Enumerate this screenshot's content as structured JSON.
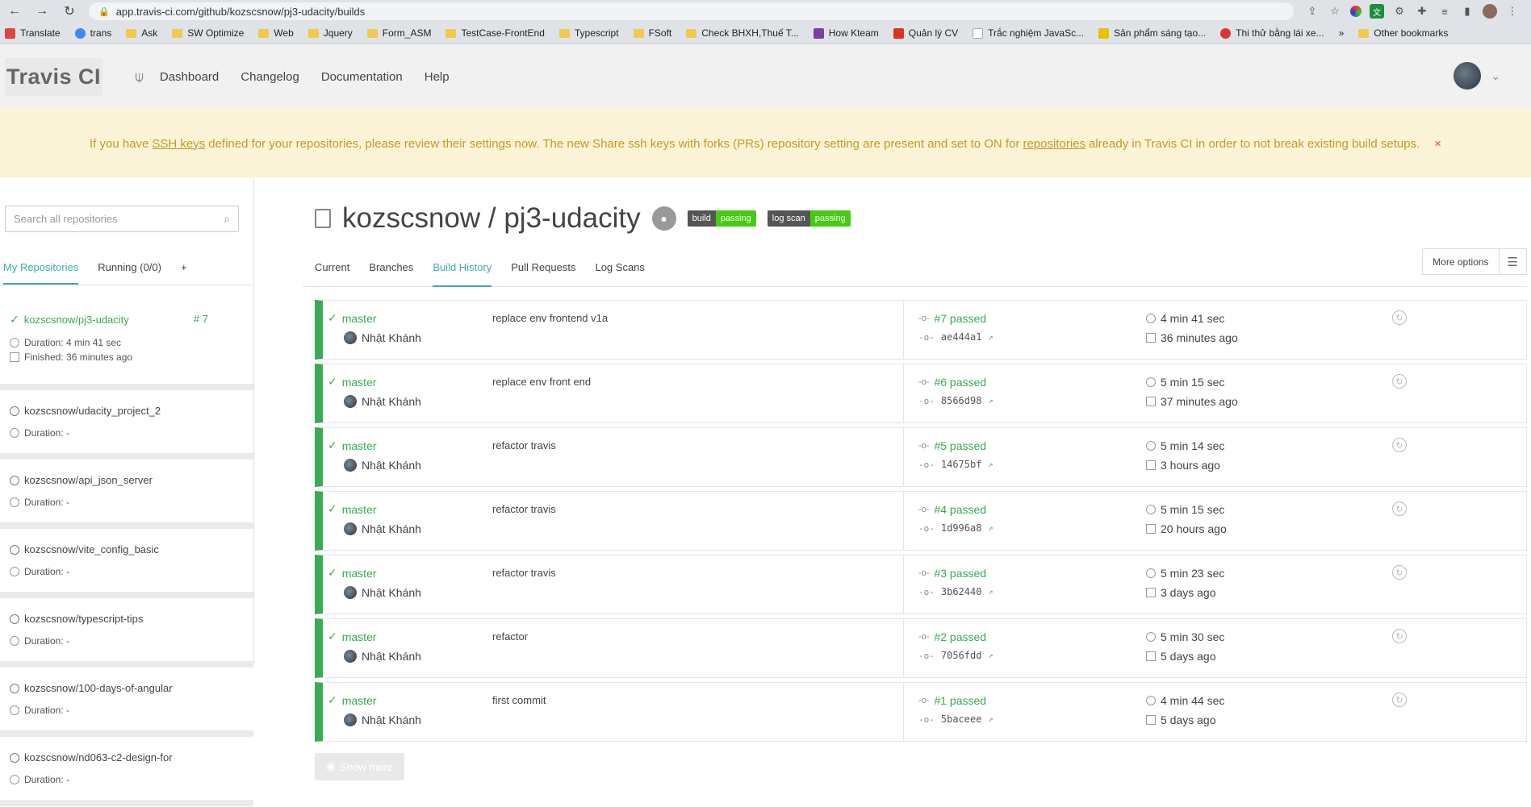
{
  "browser": {
    "url": "app.travis-ci.com/github/kozscsnow/pj3-udacity/builds",
    "bookmarks": [
      "Translate",
      "trans",
      "Ask",
      "SW Optimize",
      "Web",
      "Jquery",
      "Form_ASM",
      "TestCase-FrontEnd",
      "Typescript",
      "FSoft",
      "Check BHXH,Thuế T...",
      "How Kteam",
      "Quản lý CV",
      "Trắc nghiệm JavaSc...",
      "Sản phẩm sáng tạo...",
      "Thi thử bằng lái xe...",
      "»",
      "Other bookmarks"
    ]
  },
  "nav": {
    "logo": "Travis CI",
    "links": [
      "Dashboard",
      "Changelog",
      "Documentation",
      "Help"
    ]
  },
  "banner": {
    "prefix": "If you have",
    "link1": "SSH keys",
    "middle": "defined for your repositories, please review their settings now. The new Share ssh keys with forks (PRs) repository setting are present and set to ON for",
    "link2": "repositories",
    "suffix": "already in Travis CI in order to not break existing build setups.",
    "close": "×"
  },
  "sidebar": {
    "search_placeholder": "Search all repositories",
    "tabs": [
      "My Repositories",
      "Running (0/0)",
      "+"
    ],
    "repos": [
      {
        "name": "kozscsnow/pj3-udacity",
        "number": "7",
        "duration": "Duration: 4 min 41 sec",
        "finished": "Finished: 36 minutes ago"
      },
      {
        "name": "kozscsnow/udacity_project_2",
        "duration": "Duration: -"
      },
      {
        "name": "kozscsnow/api_json_server",
        "duration": "Duration: -"
      },
      {
        "name": "kozscsnow/vite_config_basic",
        "duration": "Duration: -"
      },
      {
        "name": "kozscsnow/typescript-tips",
        "duration": "Duration: -"
      },
      {
        "name": "kozscsnow/100-days-of-angular",
        "duration": "Duration: -"
      },
      {
        "name": "kozscsnow/nd063-c2-design-for",
        "duration": "Duration: -"
      }
    ]
  },
  "repo": {
    "title": "kozscsnow / pj3-udacity",
    "badges": [
      {
        "left": "build",
        "right": "passing"
      },
      {
        "left": "log scan",
        "right": "passing"
      }
    ],
    "tabs": [
      "Current",
      "Branches",
      "Build History",
      "Pull Requests",
      "Log Scans"
    ],
    "active_tab": "Build History",
    "more_options": "More options"
  },
  "builds": [
    {
      "branch": "master",
      "author": "Nhật Khánh",
      "message": "replace env frontend v1a",
      "state": "#7 passed",
      "sha": "ae444a1",
      "duration": "4 min 41 sec",
      "when": "36 minutes ago"
    },
    {
      "branch": "master",
      "author": "Nhật Khánh",
      "message": "replace env front end",
      "state": "#6 passed",
      "sha": "8566d98",
      "duration": "5 min 15 sec",
      "when": "37 minutes ago"
    },
    {
      "branch": "master",
      "author": "Nhật Khánh",
      "message": "refactor travis",
      "state": "#5 passed",
      "sha": "14675bf",
      "duration": "5 min 14 sec",
      "when": "3 hours ago"
    },
    {
      "branch": "master",
      "author": "Nhật Khánh",
      "message": "refactor travis",
      "state": "#4 passed",
      "sha": "1d996a8",
      "duration": "5 min 15 sec",
      "when": "20 hours ago"
    },
    {
      "branch": "master",
      "author": "Nhật Khánh",
      "message": "refactor travis",
      "state": "#3 passed",
      "sha": "3b62440",
      "duration": "5 min 23 sec",
      "when": "3 days ago"
    },
    {
      "branch": "master",
      "author": "Nhật Khánh",
      "message": "refactor",
      "state": "#2 passed",
      "sha": "7056fdd",
      "duration": "5 min 30 sec",
      "when": "5 days ago"
    },
    {
      "branch": "master",
      "author": "Nhật Khánh",
      "message": "first commit",
      "state": "#1 passed",
      "sha": "5baceee",
      "duration": "4 min 44 sec",
      "when": "5 days ago"
    }
  ],
  "show_more": "Show more",
  "colors": {
    "success": "#39aa56",
    "accent": "#3eaaaf",
    "banner_text": "#c49a26"
  }
}
